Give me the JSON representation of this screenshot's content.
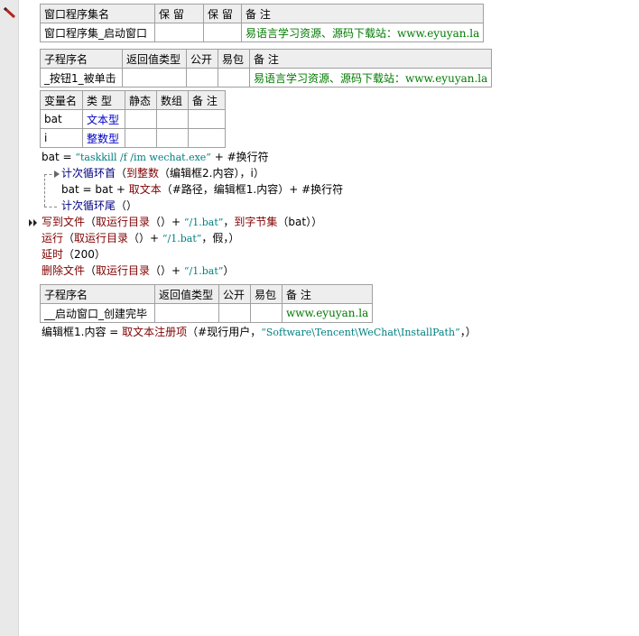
{
  "window_table": {
    "headers": [
      "窗口程序集名",
      "保 留",
      "保 留",
      "备 注"
    ],
    "row": [
      "窗口程序集_启动窗口",
      "",
      "",
      "易语言学习资源、源码下载站：www.eyuyan.la"
    ]
  },
  "sub1_table": {
    "headers": [
      "子程序名",
      "返回值类型",
      "公开",
      "易包",
      "备 注"
    ],
    "row": [
      "_按钮1_被单击",
      "",
      "",
      "",
      "易语言学习资源、源码下载站：www.eyuyan.la"
    ]
  },
  "var_table": {
    "headers": [
      "变量名",
      "类 型",
      "静态",
      "数组",
      "备 注"
    ],
    "rows": [
      [
        "bat",
        "文本型",
        "",
        "",
        ""
      ],
      [
        "i",
        "整数型",
        "",
        "",
        ""
      ]
    ]
  },
  "code": {
    "line1": {
      "var": "bat",
      "op": " = ",
      "str": "“taskkill /f /im wechat.exe”",
      "plus": " + ",
      "const": "#换行符"
    },
    "line2": {
      "kw": "计次循环首",
      "rest_a": "（",
      "fn": "到整数",
      "rest_b": "（编辑框2.内容），i）"
    },
    "line3": {
      "a": "bat = bat + ",
      "fn": "取文本",
      "b": "（#路径，编辑框1.内容）+ #换行符"
    },
    "line4": {
      "kw": "计次循环尾",
      "rest": "（）"
    },
    "line5": {
      "fn": "写到文件",
      "a": "（",
      "fn2": "取运行目录",
      "b": "（）+ ",
      "str": "“/1.bat”",
      "c": "，",
      "fn3": "到字节集",
      "d": "（bat））"
    },
    "line6": {
      "fn": "运行",
      "a": "（",
      "fn2": "取运行目录",
      "b": "（）+ ",
      "str": "“/1.bat”",
      "c": "，假，）"
    },
    "line7": {
      "fn": "延时",
      "a": "（200）"
    },
    "line8": {
      "fn": "删除文件",
      "a": "（",
      "fn2": "取运行目录",
      "b": "（）+ ",
      "str": "“/1.bat”",
      "c": "）"
    },
    "line9": {
      "a": "编辑框1.内容 = ",
      "fn": "取文本注册项",
      "b": "（#现行用户，",
      "str": "“Software\\Tencent\\WeChat\\InstallPath”",
      "c": "，）"
    }
  },
  "sub2_table": {
    "headers": [
      "子程序名",
      "返回值类型",
      "公开",
      "易包",
      "备 注"
    ],
    "row": [
      "__启动窗口_创建完毕",
      "",
      "",
      "",
      "www.eyuyan.la"
    ]
  },
  "colors": {
    "gutter": "#e9e9e9",
    "green": "#007a00",
    "blue": "#0000c8",
    "keyword": "#000080",
    "function": "#800000",
    "string": "#008080"
  },
  "icons": [
    "pencil-icon",
    "breakpoint-arrow-icon"
  ]
}
